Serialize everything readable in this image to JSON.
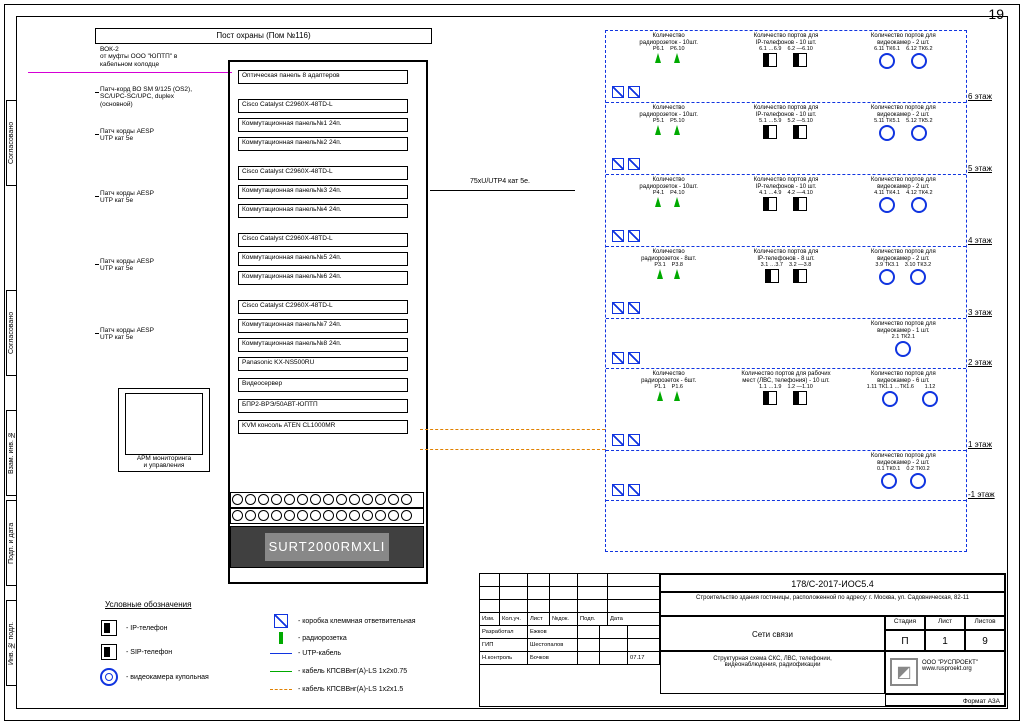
{
  "page_number": "19",
  "side_tabs": [
    "Согласовано",
    "Согласовано",
    "Взам. инв. №",
    "Подп. и дата",
    "Инв. № подл."
  ],
  "rack": {
    "title": "Пост охраны (Пом №116)",
    "top_lead": "ВОК-2\nот муфты ООО \"ЮПТП\" в\nкабельном колодце",
    "leads": [
      "Патч-корд ВО SM 9/125 (OS2),\nSC/UPC-SC/UPC, duplex\n(основной)",
      "Патч корды AESP\nUTP кат 5е",
      "Патч корды AESP\nUTP кат 5е",
      "Патч корды AESP\nUTP кат 5е",
      "Патч корды AESP\nUTP кат 5е"
    ],
    "items": [
      "Оптическая панель 8 адаптеров",
      "Cisco Catalyst C2960X-48TD-L",
      "Коммутационная панель№1 24п.",
      "Коммутационная панель№2 24п.",
      "Cisco Catalyst C2960X-48TD-L",
      "Коммутационная панель№3 24п.",
      "Коммутационная панель№4 24п.",
      "Cisco Catalyst C2960X-48TD-L",
      "Коммутационная панель№5 24п.",
      "Коммутационная панель№6 24п.",
      "Cisco Catalyst C2960X-48TD-L",
      "Коммутационная панель№7 24п.",
      "Коммутационная панель№8 24п.",
      "Panasonic KX-NS500RU",
      "Видеосервер",
      "БПР2-ВРЭ/50АВТ-ЮПТП",
      "KVM консоль ATEN CL1000MR"
    ],
    "monitor_caption": "АРМ мониторинга\nи управления",
    "ups_label": "SURT2000RMXLI"
  },
  "mid_cable": "75xU/UTP4 кат 5е.",
  "floors": [
    {
      "tag": "6 этаж",
      "radio": {
        "head": "Количество\nрадиорозеток - 10шт.",
        "labels": [
          "Р6.1",
          "Р6.10"
        ]
      },
      "ip": {
        "head": "Количество портов для\nIP-телефонов - 10 шт.",
        "labels": [
          "6.1 …6.9",
          "6.2 —6.10"
        ]
      },
      "cam": {
        "head": "Количество портов для\nвидеокамер - 2 шт.",
        "labels": [
          "6.11 ТК6.1",
          "6.12 ТК6.2"
        ]
      }
    },
    {
      "tag": "5 этаж",
      "radio": {
        "head": "Количество\nрадиорозеток - 10шт.",
        "labels": [
          "Р5.1",
          "Р5.10"
        ]
      },
      "ip": {
        "head": "Количество портов для\nIP-телефонов - 10 шт.",
        "labels": [
          "5.1 …5.9",
          "5.2 —5.10"
        ]
      },
      "cam": {
        "head": "Количество портов для\nвидеокамер - 2 шт.",
        "labels": [
          "5.11 ТК5.1",
          "5.12 ТК5.2"
        ]
      }
    },
    {
      "tag": "4 этаж",
      "radio": {
        "head": "Количество\nрадиорозеток - 10шт.",
        "labels": [
          "Р4.1",
          "Р4.10"
        ]
      },
      "ip": {
        "head": "Количество портов для\nIP-телефонов - 10 шт.",
        "labels": [
          "4.1 …4.9",
          "4.2 —4.10"
        ]
      },
      "cam": {
        "head": "Количество портов для\nвидеокамер - 2 шт.",
        "labels": [
          "4.11 ТК4.1",
          "4.12 ТК4.2"
        ]
      }
    },
    {
      "tag": "3 этаж",
      "radio": {
        "head": "Количество\nрадиорозеток - 8шт.",
        "labels": [
          "Р3.1",
          "Р3.8"
        ]
      },
      "ip": {
        "head": "Количество портов для\nIP-телефонов - 8 шт.",
        "labels": [
          "3.1 …3.7",
          "3.2 —3.8"
        ]
      },
      "cam": {
        "head": "Количество портов для\nвидеокамер - 2 шт.",
        "labels": [
          "3.9 ТК3.1",
          "3.10 ТК3.2"
        ]
      }
    },
    {
      "tag": "2 этаж",
      "cam_only": {
        "head": "Количество портов для\nвидеокамер - 1 шт.",
        "labels": [
          "2.1 ТК2.1"
        ]
      }
    },
    {
      "tag": "1 этаж",
      "radio": {
        "head": "Количество\nрадиорозеток - 6шт.",
        "labels": [
          "Р1.1",
          "Р1.6"
        ]
      },
      "ip": {
        "head": "Количество портов для рабочих\nмест (ЛВС, телефония) - 10 шт.",
        "labels": [
          "1.1 …1.9",
          "1.2 —1.10"
        ]
      },
      "cam": {
        "head": "Количество портов для\nвидеокамер - 6 шт.",
        "labels": [
          "1.11 ТК1.1 …ТК1.6",
          "1.12"
        ]
      }
    },
    {
      "tag": "-1 этаж",
      "cam_only": {
        "head": "Количество портов для\nвидеокамер - 2 шт.",
        "labels": [
          "0.1 ТК0.1",
          "0.2 ТК0.2"
        ]
      }
    }
  ],
  "legend": {
    "title": "Условные обозначения",
    "items_left": [
      "- IP-телефон",
      "- SIP-телефон",
      "- видеокамера купольная"
    ],
    "items_right": [
      "- коробка клеммная ответвительная",
      "- радиорозетка",
      "- UTP-кабель",
      "- кабель КПСВВнг(А)-LS 1х2х0.75",
      "- кабель КПСВВнг(А)-LS 1х2х1.5"
    ]
  },
  "titleblock": {
    "doc_no": "178/С-2017-ИОС5.4",
    "project": "Строительство здания гостиницы, расположенной по адресу: г. Москва, ул. Садовническая, 82-11",
    "system": "Сети связи",
    "sheet_title": "Структурная схема СКС, ЛВС, телефонии,\nвидеонаблюдения, радиофикации",
    "stage_h": "Стадия",
    "sheet_h": "Лист",
    "sheets_h": "Листов",
    "stage": "П",
    "sheet": "1",
    "sheets": "9",
    "org": "ООО \"РУСПРОЕКТ\"\nwww.rusproekt.org",
    "format": "Формат А3А",
    "grid_headers": [
      "Изм.",
      "Кол.уч.",
      "Лист",
      "№док.",
      "Подп.",
      "Дата"
    ],
    "rows": [
      [
        "Разработал",
        "Ежков",
        "",
        "",
        ""
      ],
      [
        "ГИП",
        "Шестопалов",
        "",
        "",
        ""
      ],
      [
        "Н.контроль",
        "Бочков",
        "",
        "",
        "07.17"
      ]
    ]
  }
}
